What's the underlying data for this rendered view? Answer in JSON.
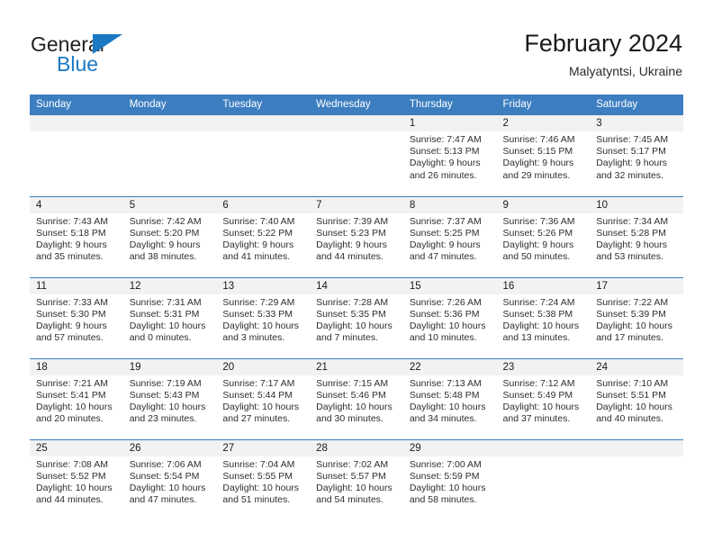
{
  "brand": {
    "name_top": "General",
    "name_bottom": "Blue",
    "accent_color": "#1b79c4"
  },
  "header": {
    "title": "February 2024",
    "subtitle": "Malyatyntsi, Ukraine"
  },
  "theme": {
    "header_blue": "#3c7ec0",
    "daynum_band": "#f2f2f2",
    "text": "#2e2e2e"
  },
  "calendar": {
    "weekday_headers": [
      "Sunday",
      "Monday",
      "Tuesday",
      "Wednesday",
      "Thursday",
      "Friday",
      "Saturday"
    ],
    "labels": {
      "sunrise": "Sunrise:",
      "sunset": "Sunset:",
      "daylight": "Daylight:"
    },
    "weeks": [
      [
        {
          "day": ""
        },
        {
          "day": ""
        },
        {
          "day": ""
        },
        {
          "day": ""
        },
        {
          "day": "1",
          "sunrise": "Sunrise: 7:47 AM",
          "sunset": "Sunset: 5:13 PM",
          "daylight_1": "Daylight: 9 hours",
          "daylight_2": "and 26 minutes."
        },
        {
          "day": "2",
          "sunrise": "Sunrise: 7:46 AM",
          "sunset": "Sunset: 5:15 PM",
          "daylight_1": "Daylight: 9 hours",
          "daylight_2": "and 29 minutes."
        },
        {
          "day": "3",
          "sunrise": "Sunrise: 7:45 AM",
          "sunset": "Sunset: 5:17 PM",
          "daylight_1": "Daylight: 9 hours",
          "daylight_2": "and 32 minutes."
        }
      ],
      [
        {
          "day": "4",
          "sunrise": "Sunrise: 7:43 AM",
          "sunset": "Sunset: 5:18 PM",
          "daylight_1": "Daylight: 9 hours",
          "daylight_2": "and 35 minutes."
        },
        {
          "day": "5",
          "sunrise": "Sunrise: 7:42 AM",
          "sunset": "Sunset: 5:20 PM",
          "daylight_1": "Daylight: 9 hours",
          "daylight_2": "and 38 minutes."
        },
        {
          "day": "6",
          "sunrise": "Sunrise: 7:40 AM",
          "sunset": "Sunset: 5:22 PM",
          "daylight_1": "Daylight: 9 hours",
          "daylight_2": "and 41 minutes."
        },
        {
          "day": "7",
          "sunrise": "Sunrise: 7:39 AM",
          "sunset": "Sunset: 5:23 PM",
          "daylight_1": "Daylight: 9 hours",
          "daylight_2": "and 44 minutes."
        },
        {
          "day": "8",
          "sunrise": "Sunrise: 7:37 AM",
          "sunset": "Sunset: 5:25 PM",
          "daylight_1": "Daylight: 9 hours",
          "daylight_2": "and 47 minutes."
        },
        {
          "day": "9",
          "sunrise": "Sunrise: 7:36 AM",
          "sunset": "Sunset: 5:26 PM",
          "daylight_1": "Daylight: 9 hours",
          "daylight_2": "and 50 minutes."
        },
        {
          "day": "10",
          "sunrise": "Sunrise: 7:34 AM",
          "sunset": "Sunset: 5:28 PM",
          "daylight_1": "Daylight: 9 hours",
          "daylight_2": "and 53 minutes."
        }
      ],
      [
        {
          "day": "11",
          "sunrise": "Sunrise: 7:33 AM",
          "sunset": "Sunset: 5:30 PM",
          "daylight_1": "Daylight: 9 hours",
          "daylight_2": "and 57 minutes."
        },
        {
          "day": "12",
          "sunrise": "Sunrise: 7:31 AM",
          "sunset": "Sunset: 5:31 PM",
          "daylight_1": "Daylight: 10 hours",
          "daylight_2": "and 0 minutes."
        },
        {
          "day": "13",
          "sunrise": "Sunrise: 7:29 AM",
          "sunset": "Sunset: 5:33 PM",
          "daylight_1": "Daylight: 10 hours",
          "daylight_2": "and 3 minutes."
        },
        {
          "day": "14",
          "sunrise": "Sunrise: 7:28 AM",
          "sunset": "Sunset: 5:35 PM",
          "daylight_1": "Daylight: 10 hours",
          "daylight_2": "and 7 minutes."
        },
        {
          "day": "15",
          "sunrise": "Sunrise: 7:26 AM",
          "sunset": "Sunset: 5:36 PM",
          "daylight_1": "Daylight: 10 hours",
          "daylight_2": "and 10 minutes."
        },
        {
          "day": "16",
          "sunrise": "Sunrise: 7:24 AM",
          "sunset": "Sunset: 5:38 PM",
          "daylight_1": "Daylight: 10 hours",
          "daylight_2": "and 13 minutes."
        },
        {
          "day": "17",
          "sunrise": "Sunrise: 7:22 AM",
          "sunset": "Sunset: 5:39 PM",
          "daylight_1": "Daylight: 10 hours",
          "daylight_2": "and 17 minutes."
        }
      ],
      [
        {
          "day": "18",
          "sunrise": "Sunrise: 7:21 AM",
          "sunset": "Sunset: 5:41 PM",
          "daylight_1": "Daylight: 10 hours",
          "daylight_2": "and 20 minutes."
        },
        {
          "day": "19",
          "sunrise": "Sunrise: 7:19 AM",
          "sunset": "Sunset: 5:43 PM",
          "daylight_1": "Daylight: 10 hours",
          "daylight_2": "and 23 minutes."
        },
        {
          "day": "20",
          "sunrise": "Sunrise: 7:17 AM",
          "sunset": "Sunset: 5:44 PM",
          "daylight_1": "Daylight: 10 hours",
          "daylight_2": "and 27 minutes."
        },
        {
          "day": "21",
          "sunrise": "Sunrise: 7:15 AM",
          "sunset": "Sunset: 5:46 PM",
          "daylight_1": "Daylight: 10 hours",
          "daylight_2": "and 30 minutes."
        },
        {
          "day": "22",
          "sunrise": "Sunrise: 7:13 AM",
          "sunset": "Sunset: 5:48 PM",
          "daylight_1": "Daylight: 10 hours",
          "daylight_2": "and 34 minutes."
        },
        {
          "day": "23",
          "sunrise": "Sunrise: 7:12 AM",
          "sunset": "Sunset: 5:49 PM",
          "daylight_1": "Daylight: 10 hours",
          "daylight_2": "and 37 minutes."
        },
        {
          "day": "24",
          "sunrise": "Sunrise: 7:10 AM",
          "sunset": "Sunset: 5:51 PM",
          "daylight_1": "Daylight: 10 hours",
          "daylight_2": "and 40 minutes."
        }
      ],
      [
        {
          "day": "25",
          "sunrise": "Sunrise: 7:08 AM",
          "sunset": "Sunset: 5:52 PM",
          "daylight_1": "Daylight: 10 hours",
          "daylight_2": "and 44 minutes."
        },
        {
          "day": "26",
          "sunrise": "Sunrise: 7:06 AM",
          "sunset": "Sunset: 5:54 PM",
          "daylight_1": "Daylight: 10 hours",
          "daylight_2": "and 47 minutes."
        },
        {
          "day": "27",
          "sunrise": "Sunrise: 7:04 AM",
          "sunset": "Sunset: 5:55 PM",
          "daylight_1": "Daylight: 10 hours",
          "daylight_2": "and 51 minutes."
        },
        {
          "day": "28",
          "sunrise": "Sunrise: 7:02 AM",
          "sunset": "Sunset: 5:57 PM",
          "daylight_1": "Daylight: 10 hours",
          "daylight_2": "and 54 minutes."
        },
        {
          "day": "29",
          "sunrise": "Sunrise: 7:00 AM",
          "sunset": "Sunset: 5:59 PM",
          "daylight_1": "Daylight: 10 hours",
          "daylight_2": "and 58 minutes."
        },
        {
          "day": ""
        },
        {
          "day": ""
        }
      ]
    ]
  }
}
